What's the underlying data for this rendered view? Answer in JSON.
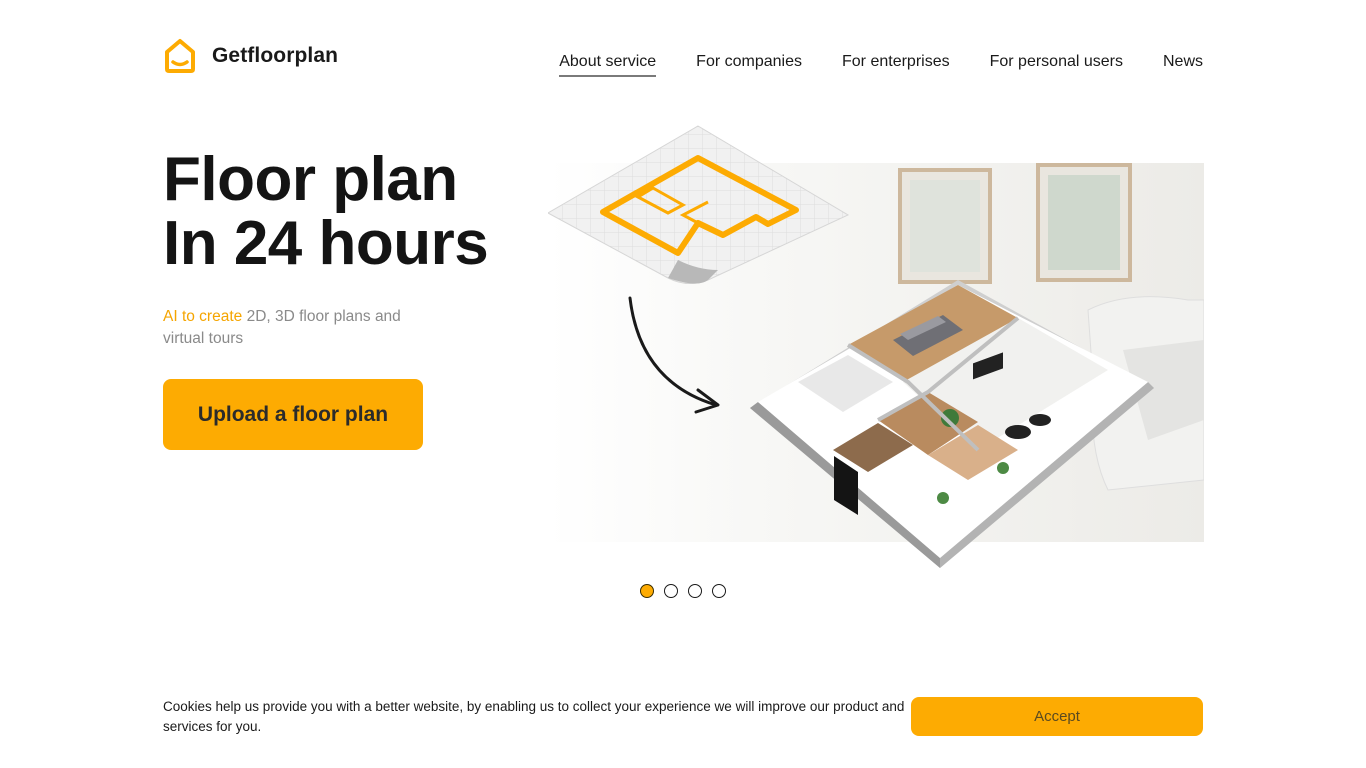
{
  "brand": {
    "name": "Getfloorplan",
    "accent_color": "#fdab02",
    "icon": "house-logo-icon"
  },
  "nav": {
    "items": [
      {
        "label": "About service",
        "active": true
      },
      {
        "label": "For companies",
        "active": false
      },
      {
        "label": "For enterprises",
        "active": false
      },
      {
        "label": "For personal users",
        "active": false
      },
      {
        "label": "News",
        "active": false
      }
    ]
  },
  "hero": {
    "title_line1": "Floor plan",
    "title_line2": "In 24 hours",
    "subtitle_accent": "AI to create",
    "subtitle_rest": " 2D, 3D floor plans and virtual tours",
    "cta_label": "Upload a floor plan"
  },
  "carousel": {
    "slide_count": 4,
    "active_index": 0
  },
  "cookie": {
    "text": "Cookies help us provide you with a better website, by enabling us to collect your experience we will improve our product and services for you.",
    "accept_label": "Accept"
  }
}
